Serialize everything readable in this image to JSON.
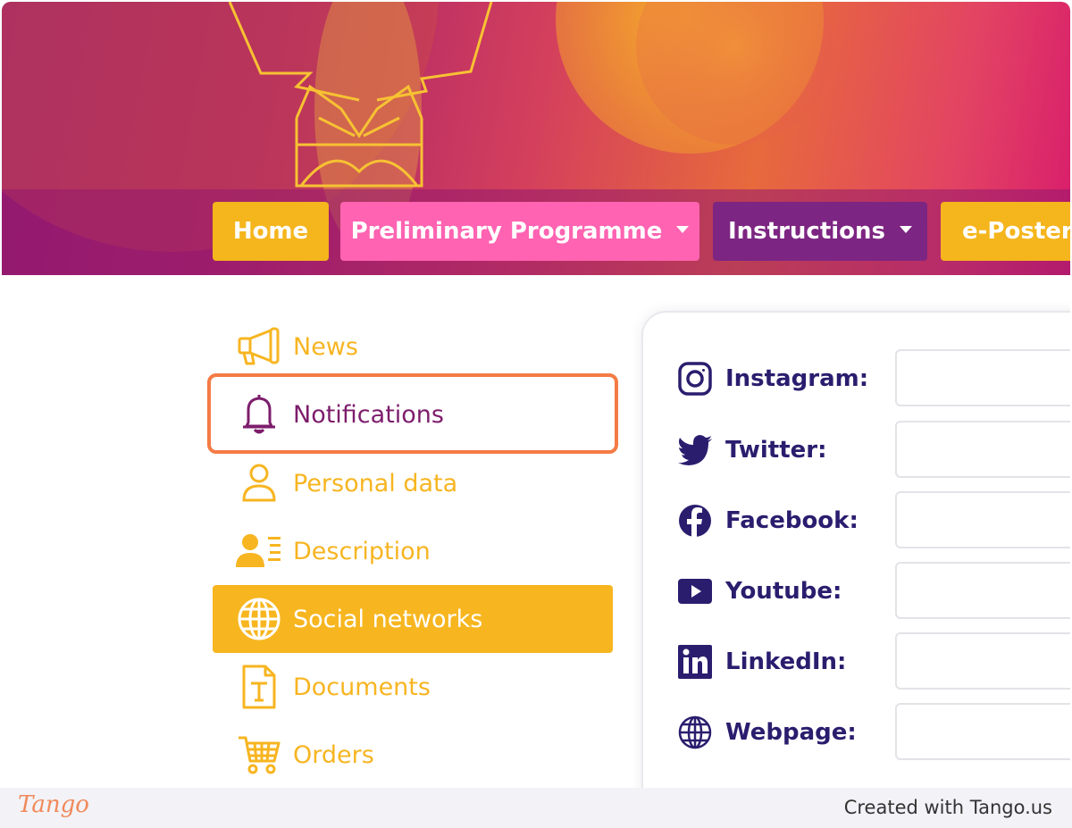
{
  "nav": {
    "home": "Home",
    "programme": "Preliminary Programme",
    "instructions": "Instructions",
    "eposters": "e-Posters"
  },
  "sidebar": {
    "items": [
      {
        "label": "News",
        "icon": "megaphone-icon"
      },
      {
        "label": "Notifications",
        "icon": "bell-icon"
      },
      {
        "label": "Personal data",
        "icon": "user-icon"
      },
      {
        "label": "Description",
        "icon": "user-list-icon"
      },
      {
        "label": "Social networks",
        "icon": "globe-icon",
        "active": true
      },
      {
        "label": "Documents",
        "icon": "document-icon"
      },
      {
        "label": "Orders",
        "icon": "cart-icon"
      }
    ]
  },
  "social": {
    "rows": [
      {
        "label": "Instagram:",
        "icon": "instagram-icon",
        "value": ""
      },
      {
        "label": "Twitter:",
        "icon": "twitter-icon",
        "value": ""
      },
      {
        "label": "Facebook:",
        "icon": "facebook-icon",
        "value": ""
      },
      {
        "label": "Youtube:",
        "icon": "youtube-icon",
        "value": ""
      },
      {
        "label": "LinkedIn:",
        "icon": "linkedin-icon",
        "value": ""
      },
      {
        "label": "Webpage:",
        "icon": "webpage-globe-icon",
        "value": ""
      }
    ]
  },
  "footer": {
    "logo": "Tango",
    "credit": "Created with Tango.us"
  },
  "colors": {
    "accent_yellow": "#f7b61f",
    "accent_pink": "#ff63b1",
    "accent_purple": "#7d2582",
    "social_label": "#2b1d6e",
    "highlight": "#f47b45"
  }
}
